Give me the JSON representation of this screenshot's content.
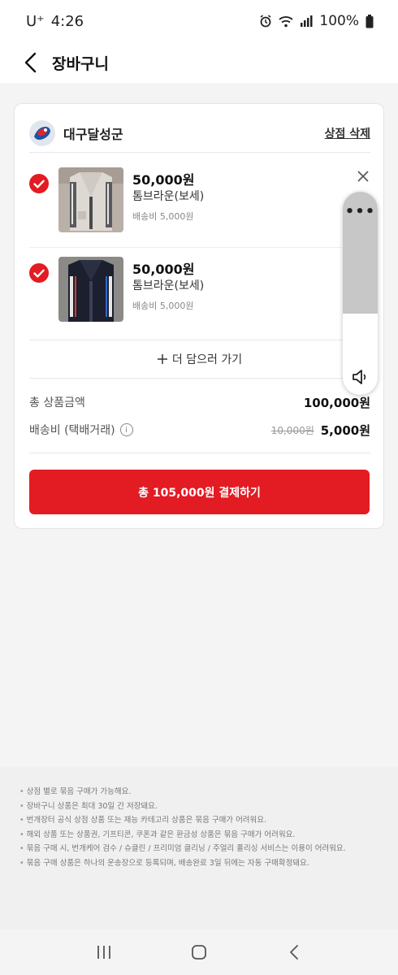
{
  "status_bar": {
    "carrier": "U⁺",
    "time": "4:26",
    "battery": "100%"
  },
  "header": {
    "title": "장바구니"
  },
  "shop": {
    "name": "대구달성군",
    "delete_label": "상점 삭제"
  },
  "items": [
    {
      "price": "50,000원",
      "name": "톰브라운(보세)",
      "shipping": "배송비 5,000원"
    },
    {
      "price": "50,000원",
      "name": "톰브라운(보세)",
      "shipping": "배송비 5,000원"
    }
  ],
  "more_label": "더 담으러 가기",
  "summary": {
    "total_label": "총 상품금액",
    "total_value": "100,000원",
    "shipping_label": "배송비 (택배거래)",
    "shipping_original": "10,000원",
    "shipping_value": "5,000원"
  },
  "pay_button": "총 105,000원 결제하기",
  "volume_panel": {
    "more_label": "•••",
    "level_fraction": 0.6
  },
  "notice": [
    "상점 별로 묶음 구매가 가능해요.",
    "장바구니 상품은 최대 30일 간 저장돼요.",
    "번개장터 공식 상점 상품 또는 재능 카테고리 상품은 묶음 구매가 어려워요.",
    "해외 상품 또는 상품권, 기프티콘, 쿠폰과 같은 환금성 상품은 묶음 구매가 어려워요.",
    "묶음 구매 시, 번개케어 검수 / 슈클린 / 프리미엄 클리닝 / 주얼리 폴리싱 서비스는 이용이 어려워요.",
    "묶음 구매 상품은 하나의 운송장으로 등록되며, 배송완료 3일 뒤에는 자동 구매확정돼요."
  ],
  "colors": {
    "accent": "#e31b23",
    "background": "#f4f4f5"
  }
}
